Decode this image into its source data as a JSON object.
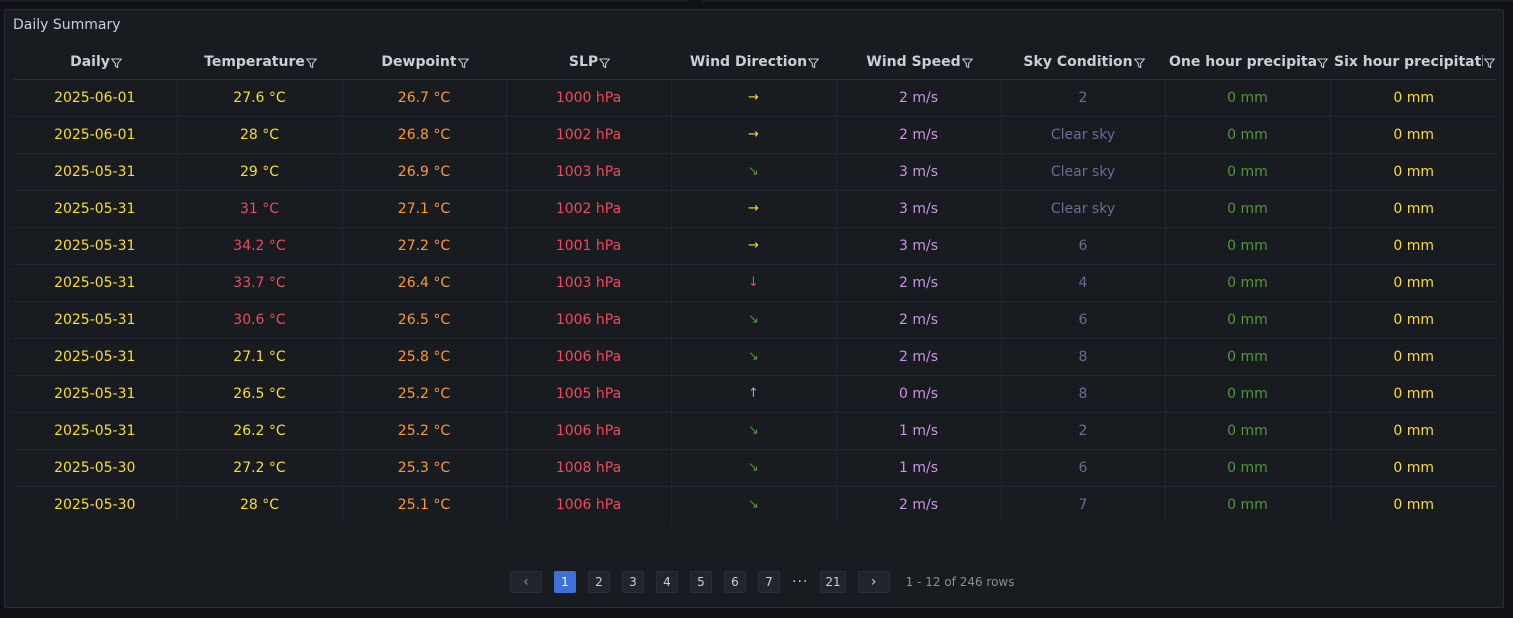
{
  "panel": {
    "title": "Daily Summary"
  },
  "columns": [
    "Daily",
    "Temperature",
    "Dewpoint",
    "SLP",
    "Wind Direction",
    "Wind Speed",
    "Sky Condition",
    "One hour precipitat",
    "Six hour precipitatio"
  ],
  "rows": [
    {
      "daily": "2025-06-01",
      "temp": "27.6 °C",
      "temp_color": "yellow",
      "dew": "26.7 °C",
      "slp": "1000 hPa",
      "dir": "→",
      "dir_color": "yellow",
      "speed": "2 m/s",
      "sky": "2",
      "p1": "0 mm",
      "p6": "0 mm"
    },
    {
      "daily": "2025-06-01",
      "temp": "28 °C",
      "temp_color": "yellow",
      "dew": "26.8 °C",
      "slp": "1002 hPa",
      "dir": "→",
      "dir_color": "yellow",
      "speed": "2 m/s",
      "sky": "Clear sky",
      "p1": "0 mm",
      "p6": "0 mm"
    },
    {
      "daily": "2025-05-31",
      "temp": "29 °C",
      "temp_color": "yellow",
      "dew": "26.9 °C",
      "slp": "1003 hPa",
      "dir": "↘",
      "dir_color": "green",
      "speed": "3 m/s",
      "sky": "Clear sky",
      "p1": "0 mm",
      "p6": "0 mm"
    },
    {
      "daily": "2025-05-31",
      "temp": "31 °C",
      "temp_color": "red",
      "dew": "27.1 °C",
      "slp": "1002 hPa",
      "dir": "→",
      "dir_color": "yellow",
      "speed": "3 m/s",
      "sky": "Clear sky",
      "p1": "0 mm",
      "p6": "0 mm"
    },
    {
      "daily": "2025-05-31",
      "temp": "34.2 °C",
      "temp_color": "red",
      "dew": "27.2 °C",
      "slp": "1001 hPa",
      "dir": "→",
      "dir_color": "yellow",
      "speed": "3 m/s",
      "sky": "6",
      "p1": "0 mm",
      "p6": "0 mm"
    },
    {
      "daily": "2025-05-31",
      "temp": "33.7 °C",
      "temp_color": "red",
      "dew": "26.4 °C",
      "slp": "1003 hPa",
      "dir": "↓",
      "dir_color": "red",
      "speed": "2 m/s",
      "sky": "4",
      "p1": "0 mm",
      "p6": "0 mm"
    },
    {
      "daily": "2025-05-31",
      "temp": "30.6 °C",
      "temp_color": "red",
      "dew": "26.5 °C",
      "slp": "1006 hPa",
      "dir": "↘",
      "dir_color": "green",
      "speed": "2 m/s",
      "sky": "6",
      "p1": "0 mm",
      "p6": "0 mm"
    },
    {
      "daily": "2025-05-31",
      "temp": "27.1 °C",
      "temp_color": "yellow",
      "dew": "25.8 °C",
      "slp": "1006 hPa",
      "dir": "↘",
      "dir_color": "green",
      "speed": "2 m/s",
      "sky": "8",
      "p1": "0 mm",
      "p6": "0 mm"
    },
    {
      "daily": "2025-05-31",
      "temp": "26.5 °C",
      "temp_color": "yellow",
      "dew": "25.2 °C",
      "slp": "1005 hPa",
      "dir": "↑",
      "dir_color": "purple",
      "speed": "0 m/s",
      "sky": "8",
      "p1": "0 mm",
      "p6": "0 mm"
    },
    {
      "daily": "2025-05-31",
      "temp": "26.2 °C",
      "temp_color": "yellow",
      "dew": "25.2 °C",
      "slp": "1006 hPa",
      "dir": "↘",
      "dir_color": "green",
      "speed": "1 m/s",
      "sky": "2",
      "p1": "0 mm",
      "p6": "0 mm"
    },
    {
      "daily": "2025-05-30",
      "temp": "27.2 °C",
      "temp_color": "yellow",
      "dew": "25.3 °C",
      "slp": "1008 hPa",
      "dir": "↘",
      "dir_color": "green",
      "speed": "1 m/s",
      "sky": "6",
      "p1": "0 mm",
      "p6": "0 mm"
    },
    {
      "daily": "2025-05-30",
      "temp": "28 °C",
      "temp_color": "yellow",
      "dew": "25.1 °C",
      "slp": "1006 hPa",
      "dir": "↘",
      "dir_color": "green",
      "speed": "2 m/s",
      "sky": "7",
      "p1": "0 mm",
      "p6": "0 mm"
    }
  ],
  "icons": {
    "filter": "filter-icon",
    "prev": "chevron-left-icon",
    "next": "chevron-right-icon"
  },
  "colors": {
    "background": "#111217",
    "panel": "#181b1f",
    "yellow": "#fade2a",
    "red": "#f2495c",
    "orange": "#ff9830",
    "purple": "#ca95e5",
    "sky": "#6e6a9a",
    "green": "#4f9a36",
    "active_page": "#3d71d9"
  },
  "pagination": {
    "prev": "‹",
    "next": "›",
    "pages": [
      "1",
      "2",
      "3",
      "4",
      "5",
      "6",
      "7"
    ],
    "ellipsis": "···",
    "last_page": "21",
    "current": "1",
    "summary": "1 - 12 of 246 rows"
  }
}
